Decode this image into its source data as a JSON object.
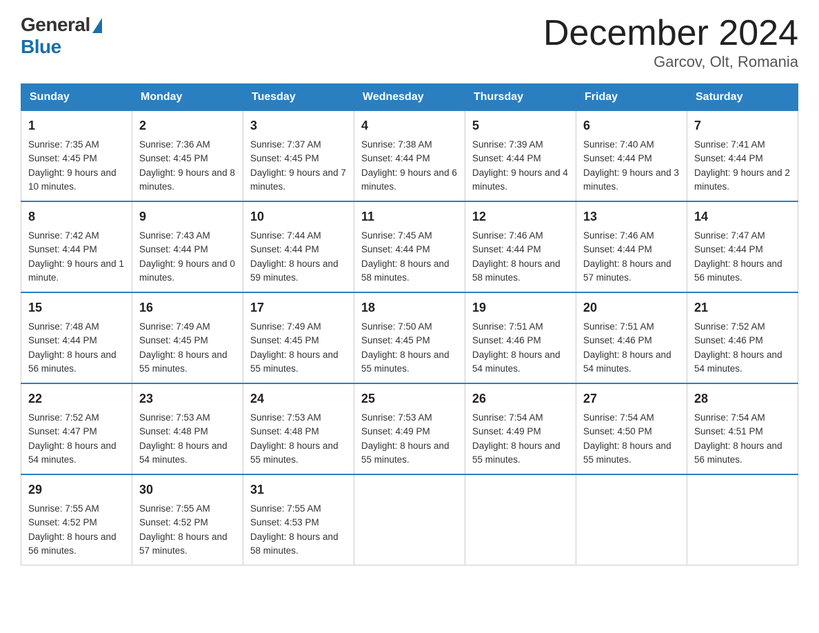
{
  "header": {
    "logo_general": "General",
    "logo_blue": "Blue",
    "month_title": "December 2024",
    "location": "Garcov, Olt, Romania"
  },
  "weekdays": [
    "Sunday",
    "Monday",
    "Tuesday",
    "Wednesday",
    "Thursday",
    "Friday",
    "Saturday"
  ],
  "weeks": [
    [
      {
        "day": "1",
        "sunrise": "7:35 AM",
        "sunset": "4:45 PM",
        "daylight": "9 hours and 10 minutes."
      },
      {
        "day": "2",
        "sunrise": "7:36 AM",
        "sunset": "4:45 PM",
        "daylight": "9 hours and 8 minutes."
      },
      {
        "day": "3",
        "sunrise": "7:37 AM",
        "sunset": "4:45 PM",
        "daylight": "9 hours and 7 minutes."
      },
      {
        "day": "4",
        "sunrise": "7:38 AM",
        "sunset": "4:44 PM",
        "daylight": "9 hours and 6 minutes."
      },
      {
        "day": "5",
        "sunrise": "7:39 AM",
        "sunset": "4:44 PM",
        "daylight": "9 hours and 4 minutes."
      },
      {
        "day": "6",
        "sunrise": "7:40 AM",
        "sunset": "4:44 PM",
        "daylight": "9 hours and 3 minutes."
      },
      {
        "day": "7",
        "sunrise": "7:41 AM",
        "sunset": "4:44 PM",
        "daylight": "9 hours and 2 minutes."
      }
    ],
    [
      {
        "day": "8",
        "sunrise": "7:42 AM",
        "sunset": "4:44 PM",
        "daylight": "9 hours and 1 minute."
      },
      {
        "day": "9",
        "sunrise": "7:43 AM",
        "sunset": "4:44 PM",
        "daylight": "9 hours and 0 minutes."
      },
      {
        "day": "10",
        "sunrise": "7:44 AM",
        "sunset": "4:44 PM",
        "daylight": "8 hours and 59 minutes."
      },
      {
        "day": "11",
        "sunrise": "7:45 AM",
        "sunset": "4:44 PM",
        "daylight": "8 hours and 58 minutes."
      },
      {
        "day": "12",
        "sunrise": "7:46 AM",
        "sunset": "4:44 PM",
        "daylight": "8 hours and 58 minutes."
      },
      {
        "day": "13",
        "sunrise": "7:46 AM",
        "sunset": "4:44 PM",
        "daylight": "8 hours and 57 minutes."
      },
      {
        "day": "14",
        "sunrise": "7:47 AM",
        "sunset": "4:44 PM",
        "daylight": "8 hours and 56 minutes."
      }
    ],
    [
      {
        "day": "15",
        "sunrise": "7:48 AM",
        "sunset": "4:44 PM",
        "daylight": "8 hours and 56 minutes."
      },
      {
        "day": "16",
        "sunrise": "7:49 AM",
        "sunset": "4:45 PM",
        "daylight": "8 hours and 55 minutes."
      },
      {
        "day": "17",
        "sunrise": "7:49 AM",
        "sunset": "4:45 PM",
        "daylight": "8 hours and 55 minutes."
      },
      {
        "day": "18",
        "sunrise": "7:50 AM",
        "sunset": "4:45 PM",
        "daylight": "8 hours and 55 minutes."
      },
      {
        "day": "19",
        "sunrise": "7:51 AM",
        "sunset": "4:46 PM",
        "daylight": "8 hours and 54 minutes."
      },
      {
        "day": "20",
        "sunrise": "7:51 AM",
        "sunset": "4:46 PM",
        "daylight": "8 hours and 54 minutes."
      },
      {
        "day": "21",
        "sunrise": "7:52 AM",
        "sunset": "4:46 PM",
        "daylight": "8 hours and 54 minutes."
      }
    ],
    [
      {
        "day": "22",
        "sunrise": "7:52 AM",
        "sunset": "4:47 PM",
        "daylight": "8 hours and 54 minutes."
      },
      {
        "day": "23",
        "sunrise": "7:53 AM",
        "sunset": "4:48 PM",
        "daylight": "8 hours and 54 minutes."
      },
      {
        "day": "24",
        "sunrise": "7:53 AM",
        "sunset": "4:48 PM",
        "daylight": "8 hours and 55 minutes."
      },
      {
        "day": "25",
        "sunrise": "7:53 AM",
        "sunset": "4:49 PM",
        "daylight": "8 hours and 55 minutes."
      },
      {
        "day": "26",
        "sunrise": "7:54 AM",
        "sunset": "4:49 PM",
        "daylight": "8 hours and 55 minutes."
      },
      {
        "day": "27",
        "sunrise": "7:54 AM",
        "sunset": "4:50 PM",
        "daylight": "8 hours and 55 minutes."
      },
      {
        "day": "28",
        "sunrise": "7:54 AM",
        "sunset": "4:51 PM",
        "daylight": "8 hours and 56 minutes."
      }
    ],
    [
      {
        "day": "29",
        "sunrise": "7:55 AM",
        "sunset": "4:52 PM",
        "daylight": "8 hours and 56 minutes."
      },
      {
        "day": "30",
        "sunrise": "7:55 AM",
        "sunset": "4:52 PM",
        "daylight": "8 hours and 57 minutes."
      },
      {
        "day": "31",
        "sunrise": "7:55 AM",
        "sunset": "4:53 PM",
        "daylight": "8 hours and 58 minutes."
      },
      null,
      null,
      null,
      null
    ]
  ],
  "labels": {
    "sunrise": "Sunrise:",
    "sunset": "Sunset:",
    "daylight": "Daylight:"
  }
}
